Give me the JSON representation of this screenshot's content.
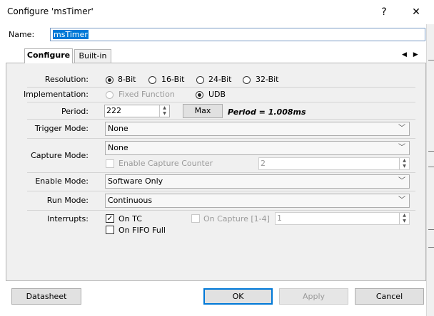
{
  "window": {
    "title": "Configure 'msTimer'",
    "help_glyph": "?",
    "close_glyph": "✕"
  },
  "name": {
    "label": "Name:",
    "value": "msTimer"
  },
  "tabs": [
    {
      "label": "Configure"
    },
    {
      "label": "Built-in"
    }
  ],
  "tab_scroll_glyphs": "◀ ▶",
  "resolution": {
    "label": "Resolution:",
    "options": [
      "8-Bit",
      "16-Bit",
      "24-Bit",
      "32-Bit"
    ],
    "selected": "8-Bit"
  },
  "implementation": {
    "label": "Implementation:",
    "options": [
      "Fixed Function",
      "UDB"
    ],
    "selected": "UDB"
  },
  "period": {
    "label": "Period:",
    "value": "222",
    "max_button": "Max",
    "info": "Period = 1.008ms"
  },
  "trigger_mode": {
    "label": "Trigger Mode:",
    "value": "None"
  },
  "capture_mode": {
    "label": "Capture Mode:",
    "value": "None",
    "enable_capture_counter": "Enable Capture Counter",
    "counter_value": "2"
  },
  "enable_mode": {
    "label": "Enable Mode:",
    "value": "Software Only"
  },
  "run_mode": {
    "label": "Run Mode:",
    "value": "Continuous"
  },
  "interrupts": {
    "label": "Interrupts:",
    "on_tc": "On TC",
    "on_tc_checked": true,
    "on_fifo_full": "On FIFO Full",
    "on_fifo_full_checked": false,
    "on_capture": "On Capture [1-4]",
    "on_capture_value": "1"
  },
  "footer": {
    "datasheet": "Datasheet",
    "ok": "OK",
    "apply": "Apply",
    "cancel": "Cancel"
  },
  "colors": {
    "accent": "#0078d7",
    "panel": "#f0f0f0",
    "border": "#adadad"
  }
}
